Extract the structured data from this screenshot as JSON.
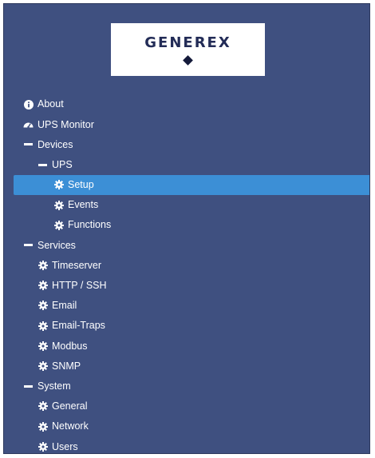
{
  "brand": {
    "logo_text": "GENEREX",
    "accent_color": "#3c8fd6",
    "background_color": "#3f5080"
  },
  "nav": {
    "items": [
      {
        "label": "About",
        "icon": "info-icon",
        "active": false
      },
      {
        "label": "UPS Monitor",
        "icon": "dashboard-icon",
        "active": false
      },
      {
        "label": "Devices",
        "icon": "minus-icon",
        "active": false
      },
      {
        "label": "UPS",
        "icon": "minus-icon",
        "active": false
      },
      {
        "label": "Setup",
        "icon": "gear-icon",
        "active": true
      },
      {
        "label": "Events",
        "icon": "gear-icon",
        "active": false
      },
      {
        "label": "Functions",
        "icon": "gear-icon",
        "active": false
      },
      {
        "label": "Services",
        "icon": "minus-icon",
        "active": false
      },
      {
        "label": "Timeserver",
        "icon": "gear-icon",
        "active": false
      },
      {
        "label": "HTTP / SSH",
        "icon": "gear-icon",
        "active": false
      },
      {
        "label": "Email",
        "icon": "gear-icon",
        "active": false
      },
      {
        "label": "Email-Traps",
        "icon": "gear-icon",
        "active": false
      },
      {
        "label": "Modbus",
        "icon": "gear-icon",
        "active": false
      },
      {
        "label": "SNMP",
        "icon": "gear-icon",
        "active": false
      },
      {
        "label": "System",
        "icon": "minus-icon",
        "active": false
      },
      {
        "label": "General",
        "icon": "gear-icon",
        "active": false
      },
      {
        "label": "Network",
        "icon": "gear-icon",
        "active": false
      },
      {
        "label": "Users",
        "icon": "gear-icon",
        "active": false
      }
    ]
  }
}
